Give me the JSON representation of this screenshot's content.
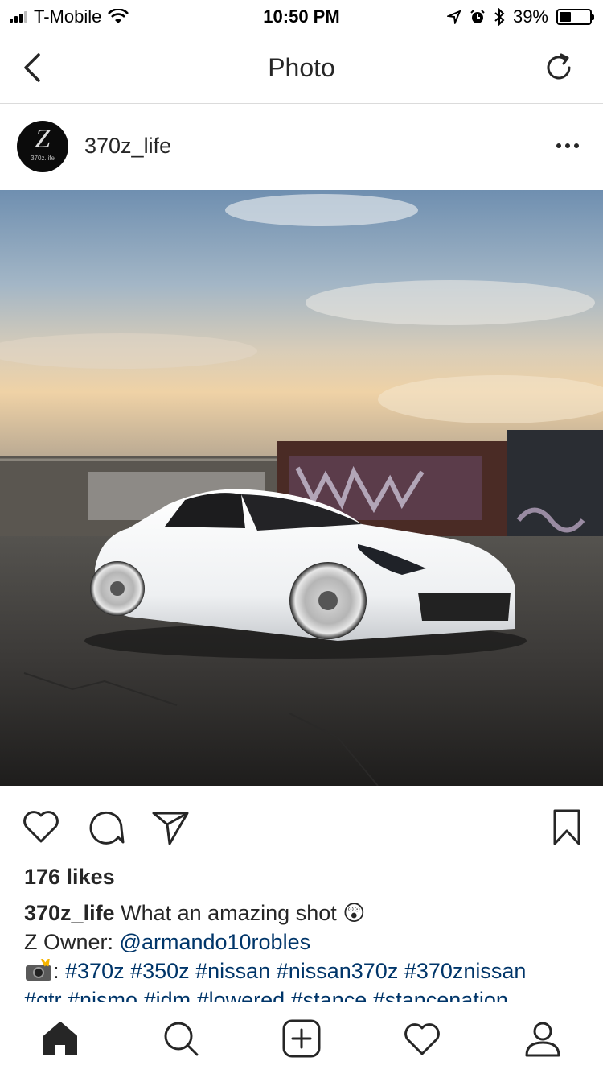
{
  "status": {
    "carrier": "T-Mobile",
    "time": "10:50 PM",
    "battery": "39%",
    "battery_level": 0.39
  },
  "nav": {
    "title": "Photo",
    "back_icon": "chevron-left-icon",
    "refresh_icon": "refresh-icon"
  },
  "post": {
    "username": "370z_life",
    "avatar_text": "Z",
    "avatar_subtext": "370z.life",
    "more_icon": "ellipsis-icon"
  },
  "actions": {
    "like_icon": "heart-icon",
    "comment_icon": "comment-icon",
    "share_icon": "paper-plane-icon",
    "save_icon": "bookmark-icon"
  },
  "likes": "176 likes",
  "caption": {
    "username": "370z_life",
    "text": "What an amazing shot 😲",
    "owner_label": "Z Owner:",
    "owner_handle": "@armando10robles",
    "camera_emoji": "camera-flash-emoji",
    "tags_line1": "#370z #350z #nissan #nissan370z #370znissan",
    "tags_line2": "#gtr #nismo #jdm #lowered #stance #stancenation"
  },
  "tabs": [
    {
      "name": "home-icon"
    },
    {
      "name": "search-icon"
    },
    {
      "name": "add-post-icon"
    },
    {
      "name": "activity-heart-icon"
    },
    {
      "name": "profile-icon"
    }
  ],
  "colors": {
    "text": "#262626",
    "link": "#003569",
    "divider": "#dbdbdb"
  }
}
